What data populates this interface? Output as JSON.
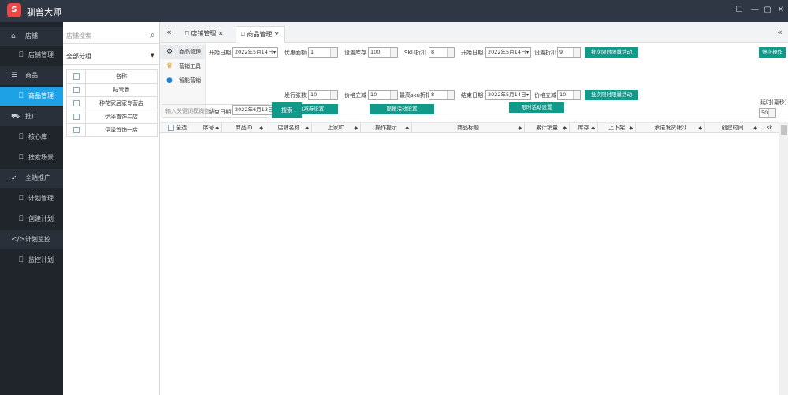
{
  "app": {
    "title": "驯兽大师",
    "logo_text": "S"
  },
  "window": {
    "controls": [
      "pin-icon",
      "minimize-icon",
      "maximize-icon",
      "close-icon"
    ]
  },
  "sidebar": {
    "items": [
      {
        "label": "店铺",
        "icon": "home-icon"
      },
      {
        "label": "店铺管理",
        "icon": "bookmark-icon"
      },
      {
        "label": "商品",
        "icon": "list-icon"
      },
      {
        "label": "商品管理",
        "icon": "bookmark-icon"
      },
      {
        "label": "推广",
        "icon": "car-icon"
      },
      {
        "label": "核心库",
        "icon": "bookmark-icon"
      },
      {
        "label": "搜索场景",
        "icon": "bookmark-icon"
      },
      {
        "label": "全站推广",
        "icon": "rocket-icon"
      },
      {
        "label": "计划管理",
        "icon": "bookmark-icon"
      },
      {
        "label": "创建计划",
        "icon": "bookmark-icon"
      },
      {
        "label": "计划监控",
        "icon": "code-icon"
      },
      {
        "label": "监控计划",
        "icon": "bookmark-icon"
      }
    ]
  },
  "shops": {
    "search_placeholder": "店铺搜索",
    "group_select": "全部分组",
    "header": "名称",
    "rows": [
      "陆鹭香",
      "种花家居家专营店",
      "伊泽首饰二店",
      "伊泽首饰一店"
    ]
  },
  "tabs": [
    {
      "label": "店铺管理"
    },
    {
      "label": "商品管理"
    }
  ],
  "toolpanel": {
    "menu": [
      {
        "label": "商品管理"
      },
      {
        "label": "营销工具"
      },
      {
        "label": "智能营销"
      }
    ],
    "left": {
      "start_date_label": "开始日期",
      "start_date": "2022年5月14日",
      "end_date_label": "结束日期",
      "end_date": "2022年6月13日",
      "coupon_label": "优惠面额",
      "coupon_value": "1",
      "issue_label": "发行张数",
      "issue_value": "10",
      "coupon_btn": "立减券设置"
    },
    "mid": {
      "stock_label": "设置库存",
      "stock_value": "100",
      "sku_discount_label": "SKU折扣",
      "sku_discount_value": "8",
      "price_label": "价格立减",
      "price_value": "10",
      "max_sku_label": "最高sku折扣",
      "max_sku_value": "8",
      "limited_btn": "限量活动设置"
    },
    "right": {
      "start_date_label": "开始日期",
      "start_date": "2022年5月14日",
      "end_date_label": "结束日期",
      "end_date": "2022年5月14日",
      "discount_label": "设置折扣",
      "discount_value": "9",
      "price_label": "价格立减",
      "price_value": "10",
      "batch_btn1": "批次限时限量活动",
      "batch_btn2": "批次限时限量活动",
      "timed_btn": "限时活动设置"
    },
    "far": {
      "stop_btn": "停止操作",
      "delay_label": "延时(毫秒)",
      "delay_value": "500"
    }
  },
  "search": {
    "placeholder": "输入关键词模糊查询",
    "button": "搜索"
  },
  "grid": {
    "columns": [
      "全选",
      "序号",
      "商品ID",
      "店铺名称",
      "上家ID",
      "操作提示",
      "商品标题",
      "累计销量",
      "库存",
      "上下架",
      "承诺发货(秒)",
      "创建时间",
      "sk"
    ]
  }
}
